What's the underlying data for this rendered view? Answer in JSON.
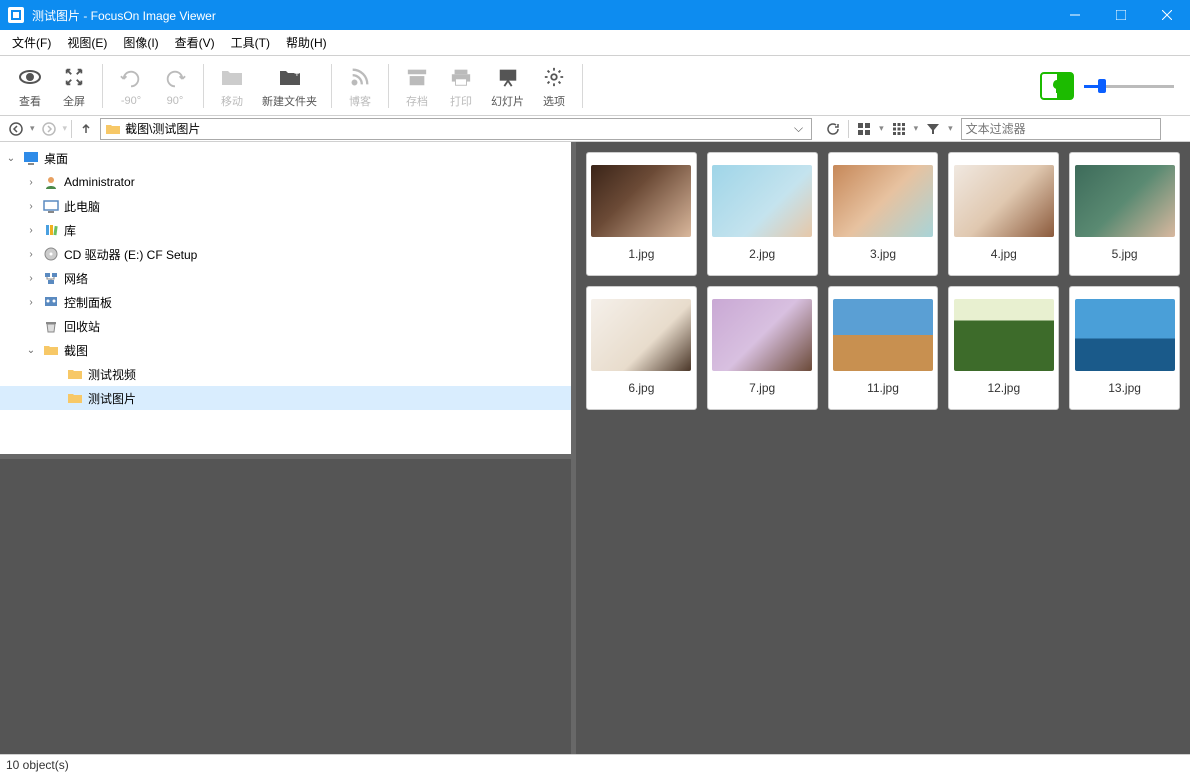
{
  "window": {
    "title": "测试图片 - FocusOn Image Viewer"
  },
  "menu": {
    "file": "文件(F)",
    "view": "视图(E)",
    "image": "图像(I)",
    "look": "查看(V)",
    "tools": "工具(T)",
    "help": "帮助(H)"
  },
  "toolbar": {
    "view": "查看",
    "full": "全屏",
    "rotL": "-90°",
    "rotR": "90°",
    "move": "移动",
    "newfolder": "新建文件夹",
    "blog": "博客",
    "archive": "存档",
    "print": "打印",
    "slide": "幻灯片",
    "options": "选项"
  },
  "nav": {
    "path": "截图\\测试图片",
    "filter_ph": "文本过滤器"
  },
  "tree": {
    "desktop": "桌面",
    "admin": "Administrator",
    "thispc": "此电脑",
    "library": "库",
    "cddrive": "CD 驱动器 (E:) CF Setup",
    "network": "网络",
    "control": "控制面板",
    "recycle": "回收站",
    "screenshot": "截图",
    "testvideo": "测试视频",
    "testimage": "测试图片"
  },
  "thumbs": [
    {
      "name": "1.jpg",
      "bg": "linear-gradient(135deg,#3a2418,#6b4a36 40%,#d9b79c)"
    },
    {
      "name": "2.jpg",
      "bg": "linear-gradient(135deg,#9fd5e8,#c4e3ee 60%,#e6c7a8)"
    },
    {
      "name": "3.jpg",
      "bg": "linear-gradient(135deg,#c68859,#e7c2a0 50%,#a8d4d8)"
    },
    {
      "name": "4.jpg",
      "bg": "linear-gradient(135deg,#f0e8e0,#e0c8b0 50%,#8b5a3c)"
    },
    {
      "name": "5.jpg",
      "bg": "linear-gradient(135deg,#3d6b5a,#5a8a72 50%,#d9b89f)"
    },
    {
      "name": "6.jpg",
      "bg": "linear-gradient(135deg,#f5f0ea,#e8dccc 60%,#4a3628)"
    },
    {
      "name": "7.jpg",
      "bg": "linear-gradient(135deg,#c9a8d4,#d8c0e0 50%,#6b4a38)"
    },
    {
      "name": "11.jpg",
      "bg": "linear-gradient(to bottom,#5a9fd4 50%,#c89050 50%)"
    },
    {
      "name": "12.jpg",
      "bg": "linear-gradient(to bottom,#e8f0d0 30%,#3d6b2a 30%)"
    },
    {
      "name": "13.jpg",
      "bg": "linear-gradient(to bottom,#4a9fd8 55%,#1a5a8a 55%)"
    }
  ],
  "status": {
    "count": "10 object(s)"
  }
}
